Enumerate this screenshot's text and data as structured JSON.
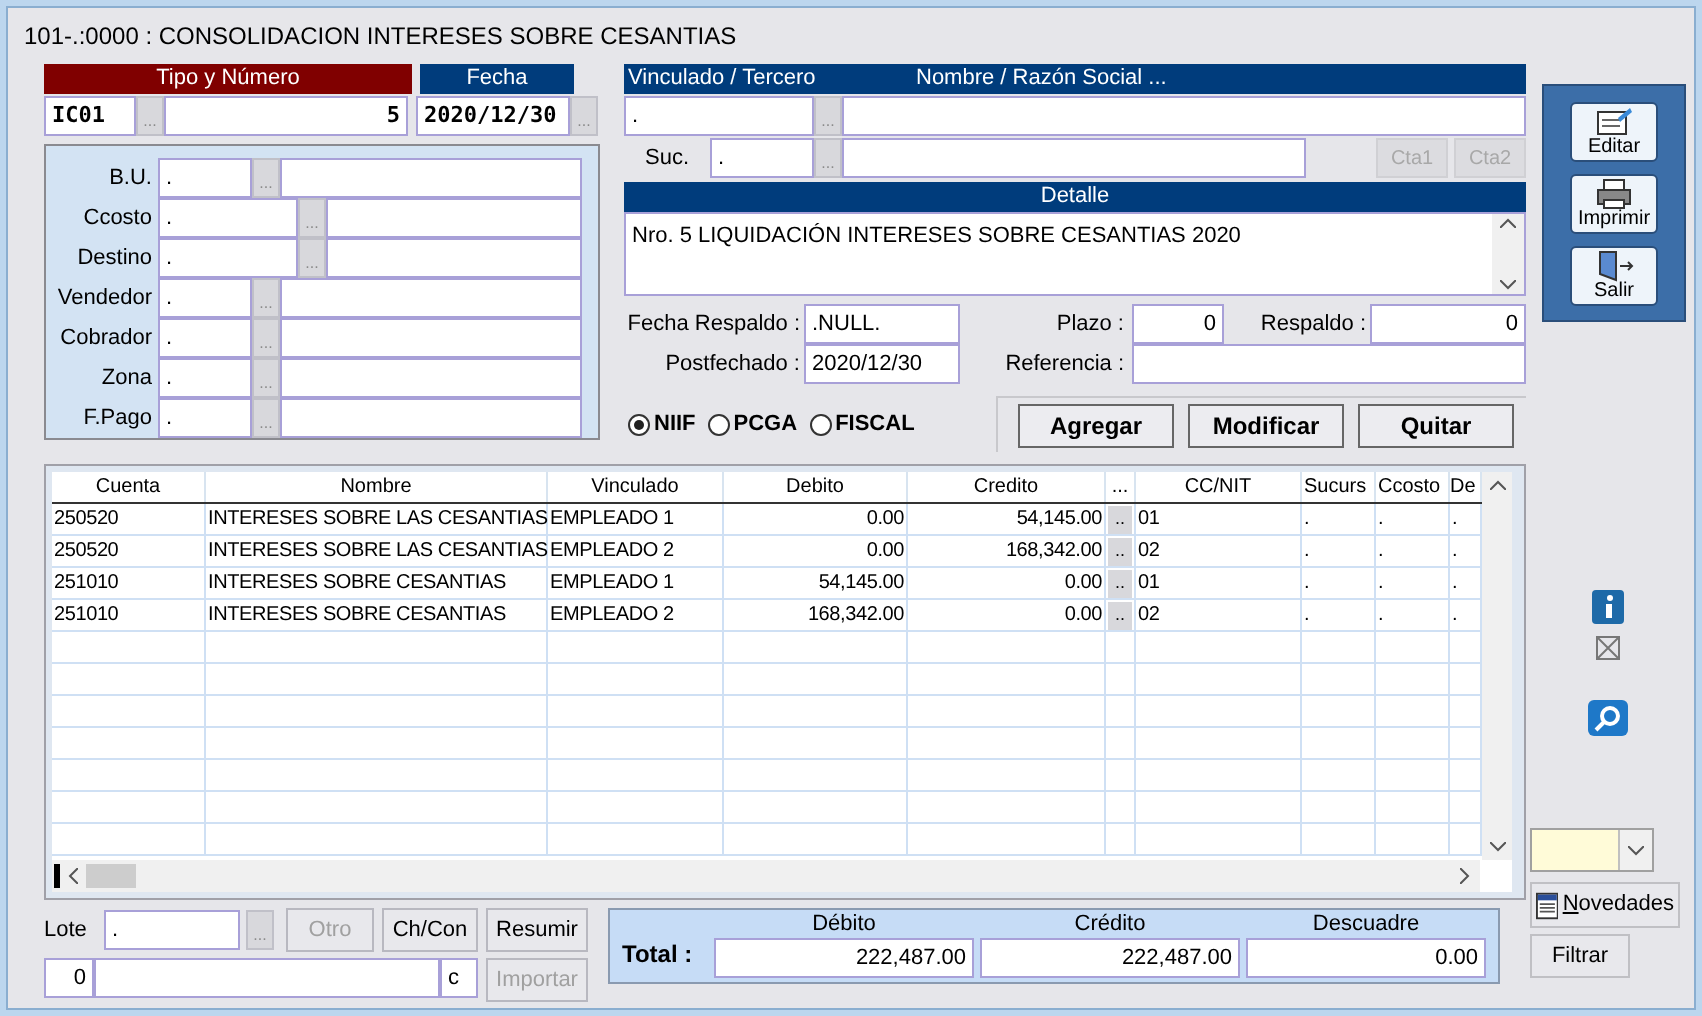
{
  "window": {
    "title": "101-.:0000 : CONSOLIDACION INTERESES SOBRE CESANTIAS"
  },
  "document": {
    "type_header": "Tipo y Número",
    "type": "IC01",
    "type_lookup": "...",
    "number": "5",
    "date_header": "Fecha",
    "date": "2020/12/30",
    "date_lookup": "..."
  },
  "classification": [
    {
      "label": "B.U.",
      "code": ".",
      "lookup": "...",
      "kind": "short"
    },
    {
      "label": "Ccosto",
      "code": ".",
      "lookup": "...",
      "kind": "long"
    },
    {
      "label": "Destino",
      "code": ".",
      "lookup": "...",
      "kind": "long"
    },
    {
      "label": "Vendedor",
      "code": ".",
      "lookup": "...",
      "kind": "short"
    },
    {
      "label": "Cobrador",
      "code": ".",
      "lookup": "...",
      "kind": "short"
    },
    {
      "label": "Zona",
      "code": ".",
      "lookup": "...",
      "kind": "short"
    },
    {
      "label": "F.Pago",
      "code": ".",
      "lookup": "...",
      "kind": "short"
    }
  ],
  "third_party": {
    "header": "Vinculado / Tercero",
    "name_header": "Nombre / Razón Social ...",
    "code": ".",
    "lookup": "...",
    "branch_label": "Suc.",
    "branch": ".",
    "branch_lookup": "...",
    "account_buttons": [
      {
        "label": "Cta1",
        "disabled": true
      },
      {
        "label": "Cta2",
        "disabled": true
      }
    ]
  },
  "detail": {
    "header": "Detalle",
    "text": "Nro. 5 LIQUIDACIÓN INTERESES SOBRE CESANTIAS 2020"
  },
  "references": {
    "backup_date": {
      "label": "Fecha Respaldo :",
      "value": ".NULL."
    },
    "term": {
      "label": "Plazo :",
      "value": "0"
    },
    "backup": {
      "label": "Respaldo :",
      "value": "0"
    },
    "postdated": {
      "label": "Postfechado :",
      "value": "2020/12/30"
    },
    "reference": {
      "label": "Referencia :"
    }
  },
  "standards": [
    {
      "label": "NIIF",
      "selected": true
    },
    {
      "label": "PCGA",
      "selected": false
    },
    {
      "label": "FISCAL",
      "selected": false
    }
  ],
  "line_actions": [
    "Agregar",
    "Modificar",
    "Quitar"
  ],
  "toolbar": [
    {
      "label": "Editar",
      "kind": "edit"
    },
    {
      "label": "Imprimir",
      "kind": "print"
    },
    {
      "label": "Salir",
      "kind": "exit"
    }
  ],
  "table": {
    "columns": [
      "Cuenta",
      "Nombre",
      "Vinculado",
      "Debito",
      "Credito",
      "...",
      "CC/NIT",
      "Sucurs",
      "Ccosto",
      "De"
    ],
    "rows": [
      {
        "cuenta": "250520",
        "nombre": "INTERESES SOBRE LAS CESANTIAS",
        "vinculado": "EMPLEADO 1",
        "debito": "0.00",
        "credito": "54,145.00",
        "lookup": "..",
        "cc_nit": "01",
        "sucurs": ".",
        "ccosto": ".",
        "column_10": "."
      },
      {
        "cuenta": "250520",
        "nombre": "INTERESES SOBRE LAS CESANTIAS",
        "vinculado": "EMPLEADO 2",
        "debito": "0.00",
        "credito": "168,342.00",
        "lookup": "..",
        "cc_nit": "02",
        "sucurs": ".",
        "ccosto": ".",
        "column_10": "."
      },
      {
        "cuenta": "251010",
        "nombre": "INTERESES SOBRE CESANTIAS",
        "vinculado": "EMPLEADO 1",
        "debito": "54,145.00",
        "credito": "0.00",
        "lookup": "..",
        "cc_nit": "01",
        "sucurs": ".",
        "ccosto": ".",
        "column_10": "."
      },
      {
        "cuenta": "251010",
        "nombre": "INTERESES SOBRE CESANTIAS",
        "vinculado": "EMPLEADO 2",
        "debito": "168,342.00",
        "credito": "0.00",
        "lookup": "..",
        "cc_nit": "02",
        "sucurs": ".",
        "ccosto": ".",
        "column_10": "."
      }
    ]
  },
  "batch": {
    "label": "Lote",
    "value": ".",
    "lookup": "...",
    "counter": "0",
    "code": "c",
    "buttons": [
      {
        "label": "Otro",
        "disabled": true
      },
      {
        "label": "Ch/Con",
        "disabled": false
      },
      {
        "label": "Resumir",
        "disabled": false
      },
      {
        "label": "Importar",
        "disabled": true
      }
    ]
  },
  "totals": {
    "label": "Total :",
    "columns": [
      {
        "header": "Débito",
        "value": "222,487.00"
      },
      {
        "header": "Crédito",
        "value": "222,487.00"
      },
      {
        "header": "Descuadre",
        "value": "0.00"
      }
    ]
  },
  "side": {
    "news_button": "Novedades",
    "filter_button": "Filtrar"
  }
}
